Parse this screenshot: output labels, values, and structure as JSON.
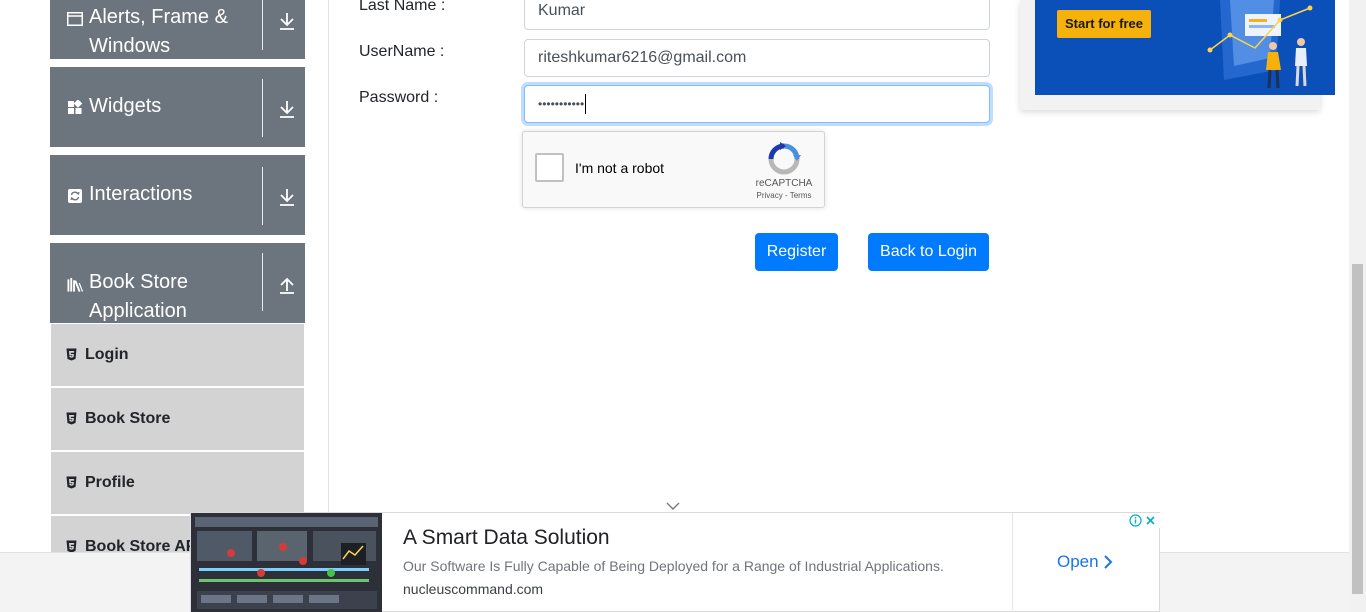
{
  "sidebar": {
    "groups": [
      {
        "label": "Alerts, Frame & Windows",
        "icon": "window-icon",
        "arrow": "download-arrow-icon"
      },
      {
        "label": "Widgets",
        "icon": "widgets-icon",
        "arrow": "download-arrow-icon"
      },
      {
        "label": "Interactions",
        "icon": "interactions-icon",
        "arrow": "download-arrow-icon"
      },
      {
        "label": "Book Store Application",
        "icon": "books-icon",
        "arrow": "upload-arrow-icon"
      }
    ],
    "items": [
      {
        "label": "Login",
        "icon": "html5-icon"
      },
      {
        "label": "Book Store",
        "icon": "html5-icon"
      },
      {
        "label": "Profile",
        "icon": "html5-icon"
      },
      {
        "label": "Book Store API",
        "icon": "html5-icon"
      }
    ]
  },
  "form": {
    "lastname_label": "Last Name :",
    "lastname_value": "Kumar",
    "username_label": "UserName :",
    "username_value": "riteshkumar6216@gmail.com",
    "password_label": "Password :",
    "password_value": "•••••••••••",
    "captcha_text": "I'm not a robot",
    "captcha_brand": "reCAPTCHA",
    "captcha_terms": "Privacy - Terms",
    "register_label": "Register",
    "back_label": "Back to Login"
  },
  "ad_top": {
    "button_label": "Start for free"
  },
  "ad_bottom": {
    "title": "A Smart Data Solution",
    "description": "Our Software Is Fully Capable of Being Deployed for a Range of Industrial Applications.",
    "url": "nucleuscommand.com",
    "open_label": "Open"
  },
  "colors": {
    "primary": "#007bff",
    "sidebar_group": "#6c757d",
    "sidebar_item": "#d3d3d3",
    "ad_banner": "#0b4fb8",
    "ad_button": "#f6b10b"
  }
}
